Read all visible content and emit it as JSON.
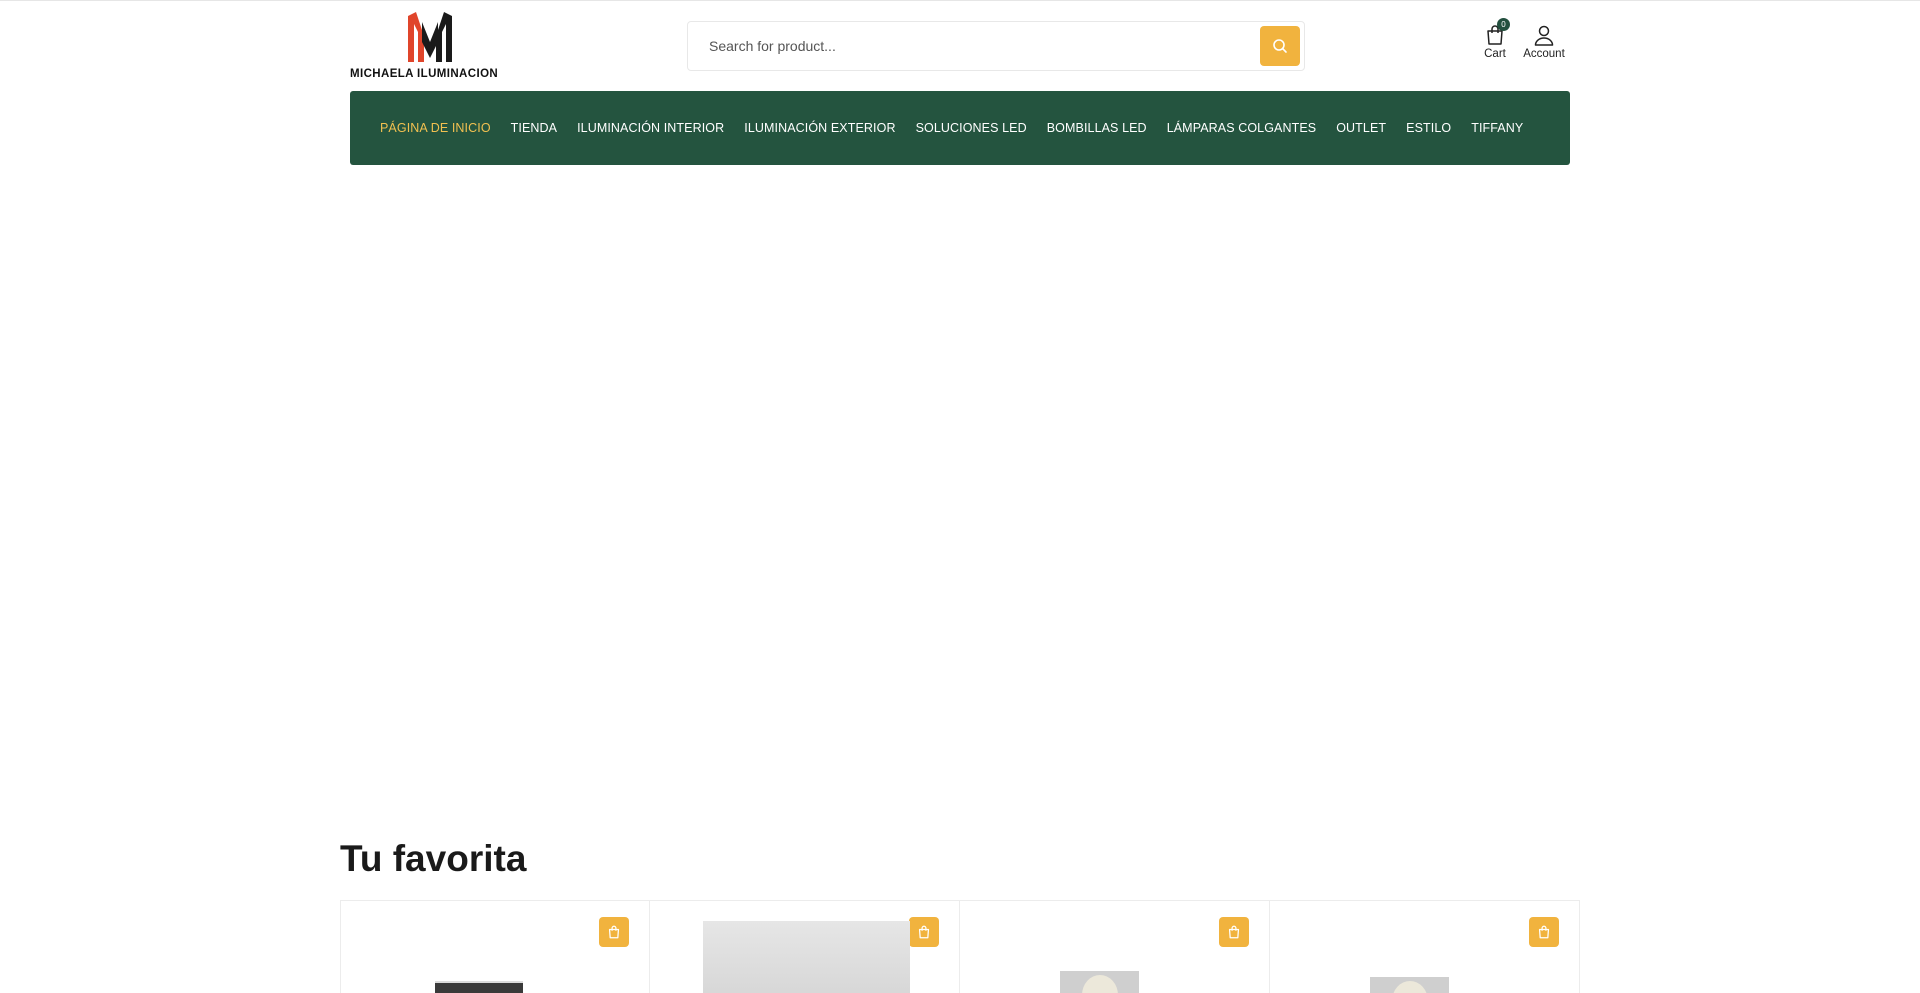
{
  "brand": {
    "logo_letters": "MM",
    "name": "MICHAELA ILUMINACION"
  },
  "search": {
    "placeholder": "Search for product..."
  },
  "header": {
    "cart_label": "Cart",
    "cart_count": "0",
    "account_label": "Account"
  },
  "nav": {
    "items": [
      {
        "label": "PÁGINA DE INICIO",
        "active": true
      },
      {
        "label": "TIENDA"
      },
      {
        "label": "ILUMINACIÓN INTERIOR"
      },
      {
        "label": "ILUMINACIÓN EXTERIOR"
      },
      {
        "label": "SOLUCIONES LED"
      },
      {
        "label": "BOMBILLAS LED"
      },
      {
        "label": "LÁMPARAS COLGANTES"
      },
      {
        "label": "OUTLET"
      },
      {
        "label": "ESTILO"
      },
      {
        "label": "TIFFANY"
      }
    ]
  },
  "favorites": {
    "title": "Tu favorita"
  },
  "colors": {
    "nav_bg": "#24543f",
    "accent": "#f1b33e",
    "active_link": "#f1c050",
    "logo_red": "#e0452b"
  },
  "icons": {
    "search": "search-icon",
    "cart": "shopping-bag-icon",
    "account": "user-icon",
    "add_to_cart": "shopping-bag-icon"
  }
}
